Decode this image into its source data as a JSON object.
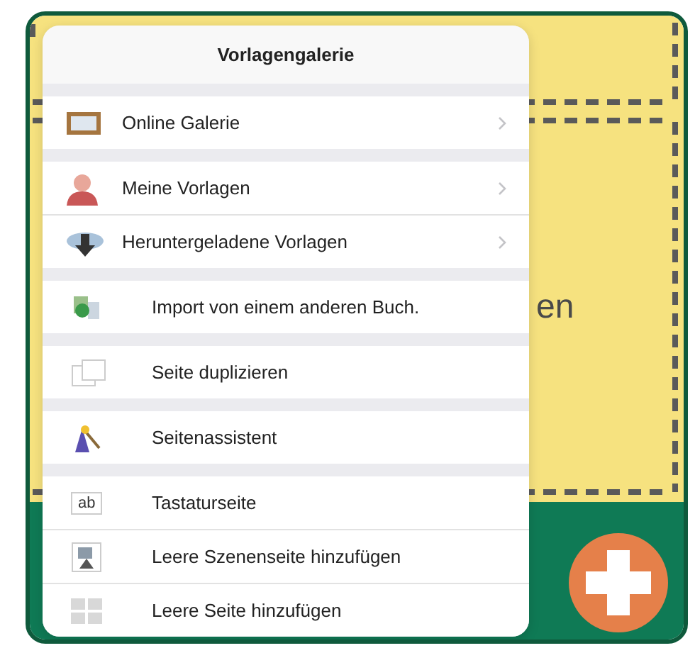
{
  "background": {
    "heading_fragment": "en"
  },
  "popover": {
    "title": "Vorlagengalerie",
    "groups": [
      {
        "items": [
          {
            "label": "Online Galerie",
            "kind": "link"
          }
        ]
      },
      {
        "items": [
          {
            "label": "Meine Vorlagen",
            "kind": "link"
          },
          {
            "label": "Heruntergeladene Vorlagen",
            "kind": "link"
          }
        ]
      },
      {
        "items": [
          {
            "label": "Import von einem anderen Buch.",
            "kind": "action"
          }
        ]
      },
      {
        "items": [
          {
            "label": "Seite duplizieren",
            "kind": "action"
          }
        ]
      },
      {
        "items": [
          {
            "label": "Seitenassistent",
            "kind": "action"
          }
        ]
      },
      {
        "items": [
          {
            "label": "Tastaturseite",
            "kind": "action",
            "icon_text": "ab"
          },
          {
            "label": "Leere Szenenseite hinzufügen",
            "kind": "action"
          },
          {
            "label": "Leere Seite hinzufügen",
            "kind": "action"
          }
        ]
      }
    ]
  }
}
